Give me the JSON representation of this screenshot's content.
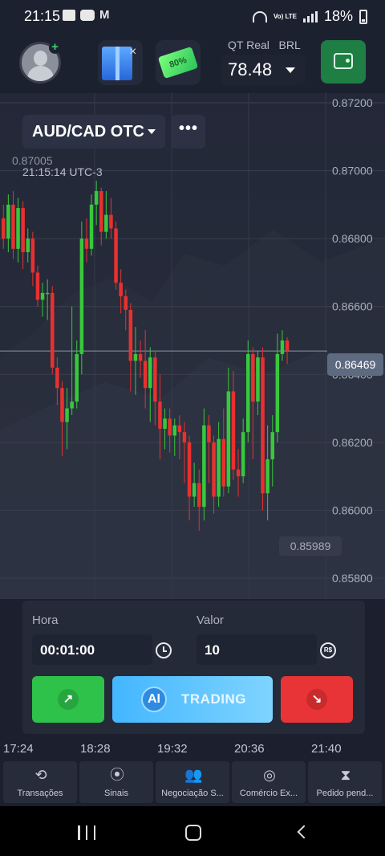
{
  "status_bar": {
    "time": "21:15",
    "volte_label": "Vo) LTE",
    "battery": "18%"
  },
  "header": {
    "account_type": "QT Real",
    "currency": "BRL",
    "balance": "78.48",
    "bonus_label": "80%",
    "icons": [
      "avatar",
      "plus-icon",
      "gift-icon",
      "close-icon",
      "bonus-ticket-icon",
      "chevron-down-icon",
      "wallet-icon"
    ]
  },
  "chart": {
    "pair": "AUD/CAD OTC",
    "more_label": "•••",
    "high_label": "0.87005",
    "time_label": "21:15:14 UTC-3",
    "current_price": "0.86469",
    "low_label": "0.85989",
    "y_ticks": [
      "0.87200",
      "0.87000",
      "0.86800",
      "0.86600",
      "0.86400",
      "0.86200",
      "0.86000",
      "0.85800"
    ],
    "x_ticks": [
      "17:24",
      "18:28",
      "19:32",
      "20:36",
      "21:40"
    ],
    "colors": {
      "up": "#38c83c",
      "down": "#e8312f",
      "axis_text": "#a7adba"
    },
    "candles": [
      [
        0.8686,
        0.868,
        0.869,
        0.8677
      ],
      [
        0.868,
        0.869,
        0.8693,
        0.8676
      ],
      [
        0.869,
        0.8677,
        0.8694,
        0.8674
      ],
      [
        0.8677,
        0.8689,
        0.8692,
        0.8673
      ],
      [
        0.8689,
        0.8676,
        0.8691,
        0.8671
      ],
      [
        0.8676,
        0.868,
        0.8683,
        0.8673
      ],
      [
        0.868,
        0.867,
        0.8682,
        0.8666
      ],
      [
        0.867,
        0.8662,
        0.8672,
        0.866
      ],
      [
        0.8662,
        0.8664,
        0.8667,
        0.8657
      ],
      [
        0.8664,
        0.8664,
        0.8668,
        0.8656
      ],
      [
        0.8664,
        0.8642,
        0.8666,
        0.864
      ],
      [
        0.8642,
        0.8636,
        0.8645,
        0.8631
      ],
      [
        0.8636,
        0.8626,
        0.8638,
        0.8616
      ],
      [
        0.8626,
        0.863,
        0.8636,
        0.8618
      ],
      [
        0.863,
        0.8632,
        0.866,
        0.8628
      ],
      [
        0.8632,
        0.8646,
        0.865,
        0.863
      ],
      [
        0.8646,
        0.868,
        0.8685,
        0.864
      ],
      [
        0.868,
        0.8677,
        0.8686,
        0.8673
      ],
      [
        0.8677,
        0.869,
        0.8693,
        0.8675
      ],
      [
        0.869,
        0.8694,
        0.8697,
        0.8684
      ],
      [
        0.8694,
        0.8682,
        0.8695,
        0.8678
      ],
      [
        0.8682,
        0.8687,
        0.8694,
        0.868
      ],
      [
        0.8687,
        0.8683,
        0.8692,
        0.868
      ],
      [
        0.8683,
        0.8667,
        0.8685,
        0.8665
      ],
      [
        0.8667,
        0.8663,
        0.8671,
        0.8658
      ],
      [
        0.8663,
        0.8659,
        0.8665,
        0.8653
      ],
      [
        0.8659,
        0.8644,
        0.8661,
        0.8635
      ],
      [
        0.8644,
        0.8646,
        0.8654,
        0.8634
      ],
      [
        0.8646,
        0.8644,
        0.865,
        0.8639
      ],
      [
        0.8644,
        0.8636,
        0.8653,
        0.863
      ],
      [
        0.8636,
        0.8645,
        0.8648,
        0.8626
      ],
      [
        0.8645,
        0.8632,
        0.8647,
        0.8625
      ],
      [
        0.8632,
        0.8624,
        0.864,
        0.8615
      ],
      [
        0.8624,
        0.8627,
        0.863,
        0.8618
      ],
      [
        0.8627,
        0.8622,
        0.863,
        0.8617
      ],
      [
        0.8622,
        0.8625,
        0.8627,
        0.8616
      ],
      [
        0.8625,
        0.8623,
        0.8628,
        0.8615
      ],
      [
        0.8623,
        0.862,
        0.8626,
        0.8608
      ],
      [
        0.862,
        0.8604,
        0.8622,
        0.8597
      ],
      [
        0.8604,
        0.8608,
        0.8614,
        0.8601
      ],
      [
        0.8608,
        0.8601,
        0.8612,
        0.8594
      ],
      [
        0.8601,
        0.8625,
        0.863,
        0.8597
      ],
      [
        0.8625,
        0.862,
        0.8628,
        0.8608
      ],
      [
        0.862,
        0.8604,
        0.8622,
        0.8599
      ],
      [
        0.8604,
        0.8621,
        0.8626,
        0.8601
      ],
      [
        0.8621,
        0.8607,
        0.863,
        0.8604
      ],
      [
        0.8607,
        0.8635,
        0.8642,
        0.8605
      ],
      [
        0.8635,
        0.8612,
        0.8641,
        0.8609
      ],
      [
        0.8612,
        0.861,
        0.8618,
        0.8604
      ],
      [
        0.861,
        0.8623,
        0.8627,
        0.8608
      ],
      [
        0.8623,
        0.8646,
        0.865,
        0.862
      ],
      [
        0.8646,
        0.8632,
        0.8648,
        0.8615
      ],
      [
        0.8632,
        0.8645,
        0.8647,
        0.8628
      ],
      [
        0.8645,
        0.8605,
        0.8648,
        0.86
      ],
      [
        0.8605,
        0.8615,
        0.8625,
        0.8597
      ],
      [
        0.8615,
        0.8623,
        0.8628,
        0.8607
      ],
      [
        0.8623,
        0.8646,
        0.8652,
        0.862
      ],
      [
        0.8646,
        0.865,
        0.8653,
        0.8644
      ],
      [
        0.865,
        0.8647,
        0.8651,
        0.8643
      ]
    ]
  },
  "trade": {
    "time_label": "Hora",
    "time_value": "00:01:00",
    "amount_label": "Valor",
    "amount_value": "10",
    "currency_symbol": "R$",
    "up_arrow": "↗",
    "down_arrow": "↘",
    "ai_badge": "AI",
    "ai_label": "TRADING"
  },
  "nav": {
    "items": [
      {
        "label": "Transações",
        "icon": "history-icon"
      },
      {
        "label": "Sinais",
        "icon": "signal-tower-icon"
      },
      {
        "label": "Negociação S...",
        "icon": "people-icon"
      },
      {
        "label": "Comércio Ex...",
        "icon": "target-icon"
      },
      {
        "label": "Pedido pend...",
        "icon": "hourglass-icon"
      }
    ]
  }
}
